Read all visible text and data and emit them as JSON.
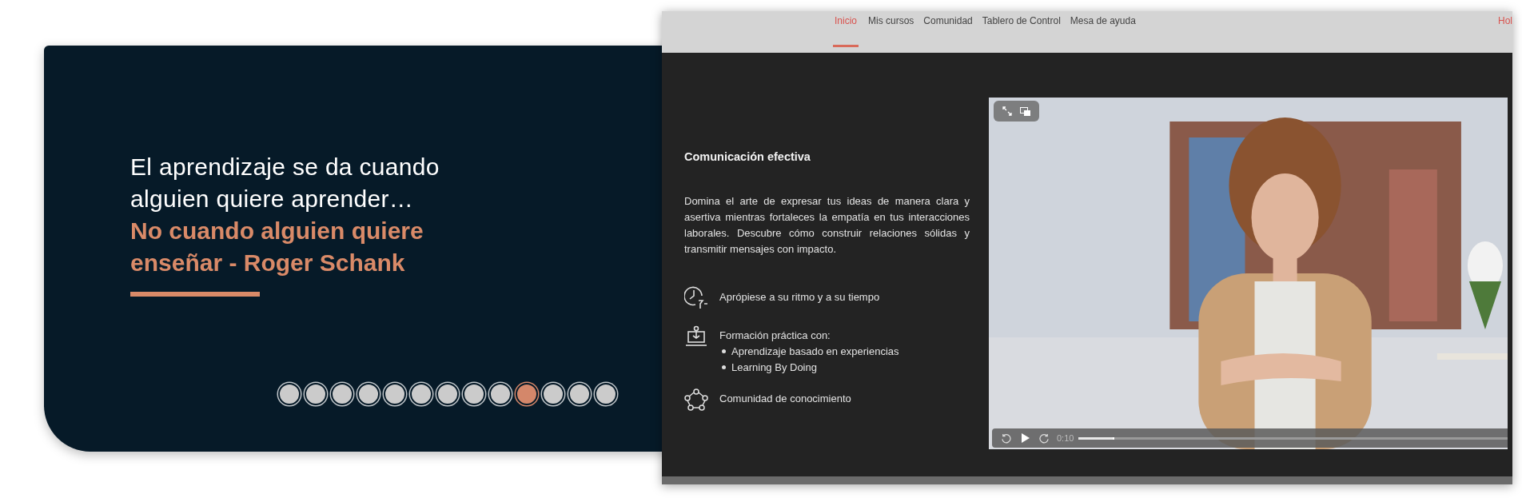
{
  "quote": {
    "text": "El aprendizaje se da cuando alguien quiere aprender…",
    "author_line": "No cuando alguien quiere enseñar - Roger Schank"
  },
  "slides": [
    {
      "selected": false
    },
    {
      "selected": false
    },
    {
      "selected": false
    },
    {
      "selected": false
    },
    {
      "selected": false
    },
    {
      "selected": false
    },
    {
      "selected": false
    },
    {
      "selected": false
    },
    {
      "selected": false
    },
    {
      "selected": true
    },
    {
      "selected": false
    },
    {
      "selected": false
    },
    {
      "selected": false
    }
  ],
  "nav": {
    "items": [
      {
        "label": "Inicio",
        "selected": true
      },
      {
        "label": "Mis cursos",
        "selected": false
      },
      {
        "label": "Comunidad",
        "selected": false
      },
      {
        "label": "Tablero de Control",
        "selected": false
      },
      {
        "label": "Mesa de ayuda",
        "selected": false
      }
    ],
    "greeting": "Hol"
  },
  "course": {
    "title": "Comunicación efectiva",
    "description": "Domina el arte de expresar tus ideas de manera clara y asertiva mientras fortaleces la empatía en tus interacciones laborales. Descubre cómo construir relaciones sólidas y transmitir mensajes con impacto.",
    "features": [
      {
        "kind": "clock",
        "text": "Aprópiese a su ritmo y a su tiempo"
      },
      {
        "kind": "laptop",
        "text": "Formación práctica con:",
        "bullets": [
          "Aprendizaje basado en experiencias",
          "Learning By Doing"
        ]
      },
      {
        "kind": "network",
        "text": "Comunidad de conocimiento"
      }
    ]
  },
  "video": {
    "kind": "picture",
    "time": "0:10",
    "level": 0.08
  }
}
